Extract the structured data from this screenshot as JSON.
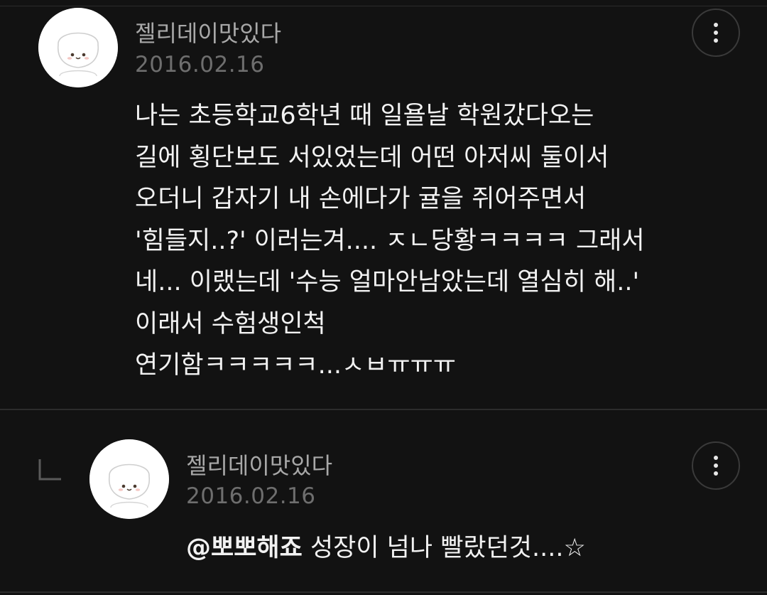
{
  "comments": [
    {
      "author": "젤리데이맛있다",
      "date": "2016.02.16",
      "avatar_icon": "cute-bear-avatar-icon",
      "more_icon": "more-vertical-icon",
      "lines": [
        "나는 초등학교6학년 때 일욜날 학원갔다오는",
        "길에 횡단보도 서있었는데 어떤 아저씨 둘이서",
        "오더니 갑자기 내 손에다가 귤을 쥐어주면서",
        "'힘들지..?' 이러는겨.... ㅈㄴ당황ㅋㅋㅋㅋ 그래서",
        "네... 이랬는데 '수능 얼마안남았는데 열심히 해..'",
        "이래서 수험생인척",
        "연기함ㅋㅋㅋㅋㅋ...ㅅㅂㅠㅠㅠ"
      ]
    }
  ],
  "reply": {
    "author": "젤리데이맛있다",
    "date": "2016.02.16",
    "avatar_icon": "cute-bear-avatar-icon",
    "more_icon": "more-vertical-icon",
    "reply_icon": "reply-corner-icon",
    "mention": "@뽀뽀해죠",
    "text": " 성장이 넘나 빨랐던것....☆"
  },
  "colors": {
    "background": "#121212",
    "text": "#f2f2f2",
    "author": "#a8a8a8",
    "date": "#6e6e6e",
    "divider": "#2c2c2c"
  }
}
